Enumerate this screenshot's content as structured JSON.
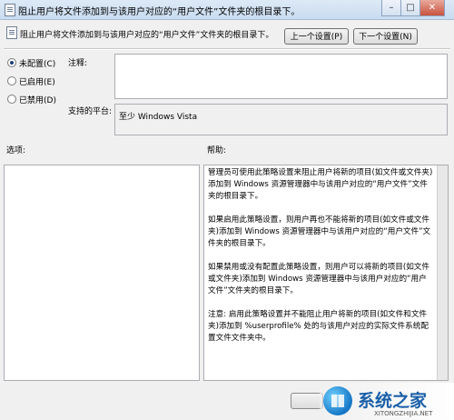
{
  "window": {
    "title": "阻止用户将文件添加到与该用户对应的“用户文件”文件夹的根目录下。",
    "controls": {
      "minimize": "–",
      "maximize": "□",
      "close": "✕"
    }
  },
  "header": {
    "setting_name": "阻止用户将文件添加到与该用户对应的“用户文件”文件夹的根目录下。",
    "prev_button": "上一个设置(P)",
    "next_button": "下一个设置(N)"
  },
  "state": {
    "options": [
      {
        "label": "未配置(C)",
        "selected": true
      },
      {
        "label": "已启用(E)",
        "selected": false
      },
      {
        "label": "已禁用(D)",
        "selected": false
      }
    ]
  },
  "comment": {
    "label": "注释:",
    "value": ""
  },
  "platform": {
    "label": "支持的平台:",
    "value": "至少 Windows Vista"
  },
  "options_section": {
    "label": "选项:"
  },
  "help_section": {
    "label": "帮助:",
    "paragraphs": [
      "管理员可使用此策略设置来阻止用户将新的项目(如文件或文件夹)添加到 Windows 资源管理器中与该用户对应的“用户文件”文件夹的根目录下。",
      "如果启用此策略设置，则用户再也不能将新的项目(如文件或文件夹)添加到 Windows 资源管理器中与该用户对应的“用户文件”文件夹的根目录下。",
      "如果禁用或没有配置此策略设置，则用户可以将新的项目(如文件或文件夹)添加到 Windows 资源管理器中与该用户对应的“用户文件”文件夹的根目录下。",
      "注意: 启用此策略设置并不能阻止用户将新的项目(如文件和文件夹)添加到 %userprofile% 处的与该用户对应的实际文件系统配置文件文件夹中。"
    ]
  },
  "watermark": {
    "text": "系统之家",
    "url": "XITONGZHIJIA.NET"
  }
}
